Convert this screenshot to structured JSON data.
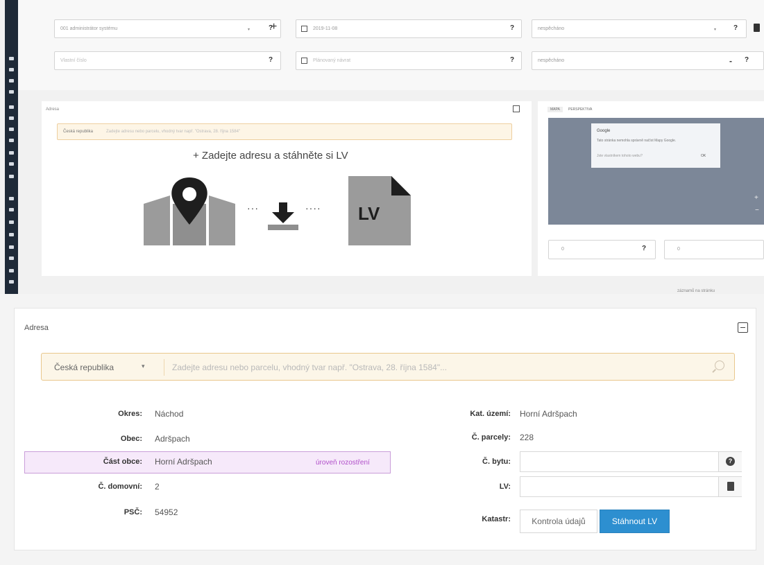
{
  "top": {
    "fields": {
      "user_value": "001 administrátor systému",
      "plus": "+",
      "date_value": "2019-11-08",
      "type_value": "nespěcháno",
      "subject_value": "Vlastní číslo",
      "deadline_placeholder": "Plánovaný návrat",
      "state_value": "nespěcháno",
      "q": "?",
      "minus": "-"
    },
    "panel_title": "Adresa",
    "search_country": "Česká republika",
    "search_placeholder": "Zadejte adresu nebo parcelu, vhodný tvar např. \"Ostrava, 28. října 1584\"",
    "hero_text": "+ Zadejte adresu a stáhněte si LV",
    "lv_label": "LV",
    "map": {
      "tabs": [
        "MAPA",
        "PERSPEKTIVA"
      ],
      "dialog_title": "Google",
      "dialog_text": "Tato stránka nemohla správně načíst Mapy Google.",
      "dialog_sub": "Jste vlastníkem tohoto webu?",
      "dialog_btn": "OK",
      "zoom_plus": "+",
      "zoom_minus": "−",
      "coord_a": "0",
      "coord_b": "0"
    },
    "pager_text": "záznamů na stránku"
  },
  "card": {
    "title": "Adresa",
    "country": "Česká republika",
    "search_placeholder": "Zadejte adresu nebo parcelu, vhodný tvar např. \"Ostrava, 28. října 1584\"...",
    "left_rows": [
      {
        "label": "Okres:",
        "value": "Náchod"
      },
      {
        "label": "Obec:",
        "value": "Adršpach"
      },
      {
        "label": "Část obce:",
        "value": "Horní Adršpach",
        "link": "úroveň rozostření"
      },
      {
        "label": "Č. domovní:",
        "value": "2"
      },
      {
        "label": "PSČ:",
        "value": "54952"
      }
    ],
    "right_rows": [
      {
        "label": "Kat. území:",
        "value": "Horní Adršpach"
      },
      {
        "label": "Č. parcely:",
        "value": "228"
      },
      {
        "label": "Č. bytu:",
        "value": ""
      },
      {
        "label": "LV:",
        "value": ""
      },
      {
        "label": "Katastr:",
        "value": ""
      }
    ],
    "btn_check": "Kontrola údajů",
    "btn_download": "Stáhnout LV"
  }
}
